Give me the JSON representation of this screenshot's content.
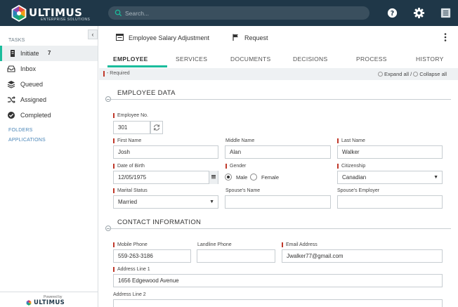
{
  "header": {
    "brand": "ULTIMUS",
    "tagline": "ENTERPRISE SOLUTIONS",
    "search_placeholder": "Search..."
  },
  "sidebar": {
    "tasks_label": "TASKS",
    "items": [
      {
        "label": "Initiate",
        "count": "7"
      },
      {
        "label": "Inbox"
      },
      {
        "label": "Queued"
      },
      {
        "label": "Assigned"
      },
      {
        "label": "Completed"
      }
    ],
    "folders_label": "FOLDERS",
    "applications_label": "APPLICATIONS",
    "powered_by": "Powered by",
    "powered_brand": "ULTIMUS"
  },
  "doc": {
    "title": "Employee Salary Adjustment",
    "request_label": "Request"
  },
  "tabs": [
    "EMPLOYEE",
    "SERVICES",
    "DOCUMENTS",
    "DECISIONS",
    "PROCESS",
    "HISTORY"
  ],
  "required_note": "- Required",
  "expand_label": "Expand all /",
  "collapse_label": "Collapse all",
  "sections": {
    "employee_data": "EMPLOYEE DATA",
    "contact_info": "CONTACT INFORMATION"
  },
  "employee": {
    "employee_no_label": "Employee No.",
    "employee_no": "301",
    "first_name_label": "First Name",
    "first_name": "Josh",
    "middle_name_label": "Middle Name",
    "middle_name": "Alan",
    "last_name_label": "Last Name",
    "last_name": "Walker",
    "dob_label": "Date of Birth",
    "dob": "12/05/1975",
    "gender_label": "Gender",
    "gender_male": "Male",
    "gender_female": "Female",
    "gender_selected": "Male",
    "citizenship_label": "Citizenship",
    "citizenship": "Canadian",
    "marital_label": "Marital Status",
    "marital": "Married",
    "spouse_name_label": "Spouse's Name",
    "spouse_name": "",
    "spouse_employer_label": "Spouse's Employer",
    "spouse_employer": ""
  },
  "contact": {
    "mobile_label": "Mobile Phone",
    "mobile": "559-263-3186",
    "landline_label": "Landline Phone",
    "landline": "",
    "email_label": "Email Address",
    "email": "Jwalker77@gmail.com",
    "addr1_label": "Address Line 1",
    "addr1": "1656 Edgewood Avenue",
    "addr2_label": "Address Line 2",
    "addr2": ""
  },
  "colors": {
    "header_bg": "#1f3748",
    "accent": "#1abc9c",
    "required": "#c0392b"
  }
}
